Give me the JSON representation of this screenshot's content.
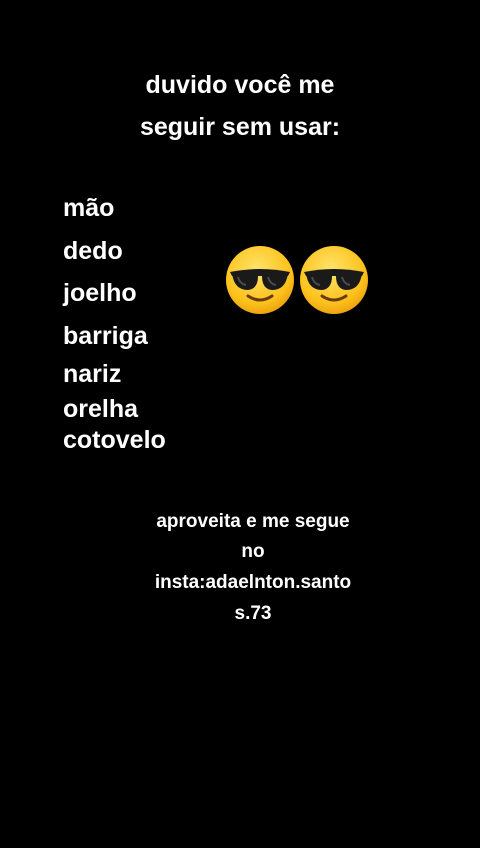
{
  "title": {
    "line1": "duvido você me",
    "line2": "seguir sem usar:"
  },
  "words": [
    "mão",
    "dedo",
    "joelho",
    "barriga",
    "nariz",
    "orelha",
    "cotovelo"
  ],
  "emojis": [
    {
      "icon": "smiling-face-with-sunglasses-icon"
    },
    {
      "icon": "smiling-face-with-sunglasses-icon"
    }
  ],
  "promo": {
    "line1": "aproveita e me segue",
    "line2": "no",
    "line3": "insta:adaelnton.santo",
    "line4": "s.73"
  },
  "colors": {
    "background": "#000000",
    "text": "#ffffff",
    "emoji_face": "#fcc21b",
    "emoji_glasses": "#1a1a1a"
  }
}
